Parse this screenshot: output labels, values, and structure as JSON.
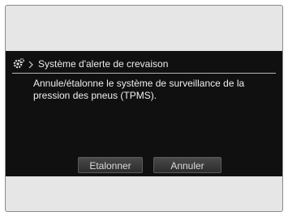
{
  "header": {
    "icon": "gear-icon",
    "separator_icon": "chevron-right-icon",
    "title": "Système d'alerte de crevaison"
  },
  "message": {
    "text": "Annule/étalonne le système de surveillance de la pression des pneus (TPMS)."
  },
  "buttons": {
    "calibrate_label": "Etalonner",
    "cancel_label": "Annuler"
  },
  "colors": {
    "screen_bg": "#101010",
    "frame_bg": "#e6e6e6",
    "text": "#efefef",
    "button_bg": "#3a3a3a"
  }
}
